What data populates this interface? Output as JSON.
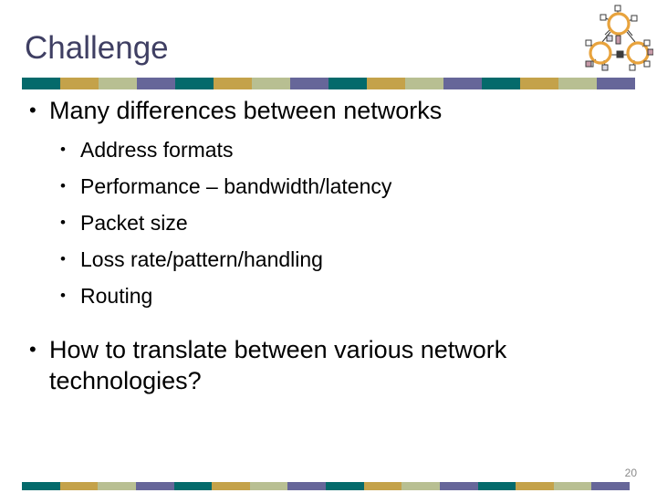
{
  "slide": {
    "title": "Challenge",
    "page_number": "20",
    "colors": {
      "title": "#3f3f63",
      "body_text": "#000000",
      "teal": "#046a6b",
      "gold": "#c4a24a",
      "sage": "#b8bf92",
      "purple": "#666699",
      "page_number": "#8a8a8a",
      "clipart_ring": "#e8a33d",
      "clipart_node": "#ffffff",
      "background": "#ffffff"
    },
    "decor_bar": {
      "name": "four-color-segment-bar",
      "segment_colors": [
        "teal",
        "gold",
        "sage",
        "purple"
      ],
      "repeats": 4
    },
    "clipart": {
      "name": "network-topology-clipart",
      "description": "three orange ring networks connected by links with square nodes"
    },
    "bullets": [
      {
        "marker": "•",
        "text": "Many differences between networks",
        "children": [
          {
            "marker": "•",
            "text": "Address formats"
          },
          {
            "marker": "•",
            "text": "Performance – bandwidth/latency"
          },
          {
            "marker": "•",
            "text": "Packet size"
          },
          {
            "marker": "•",
            "text": "Loss rate/pattern/handling"
          },
          {
            "marker": "•",
            "text": "Routing"
          }
        ]
      },
      {
        "marker": "•",
        "text": "How to translate between various network technologies?",
        "children": []
      }
    ]
  }
}
